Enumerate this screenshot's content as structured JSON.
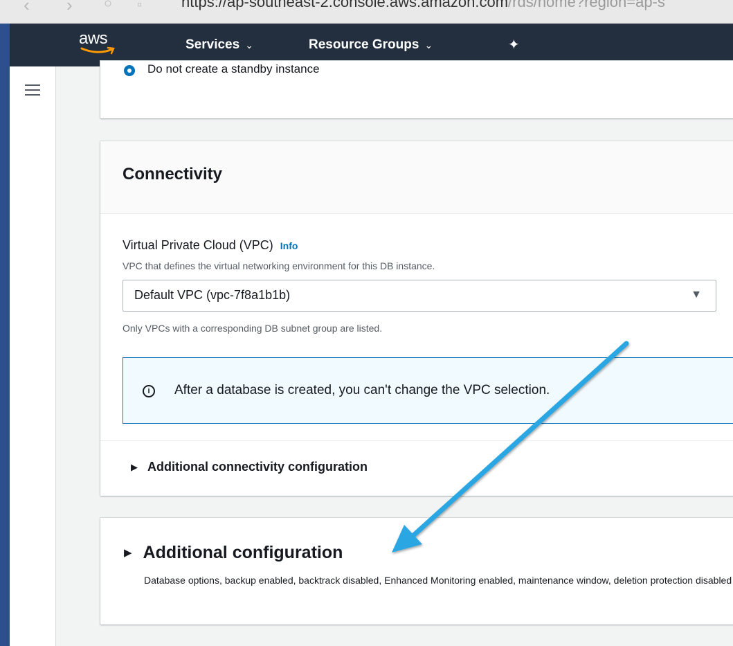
{
  "browser": {
    "url_dark": "https://ap-southeast-2.console.aws.amazon.com",
    "url_gray": "/rds/home?region=ap-s"
  },
  "header": {
    "logo": "aws",
    "services_label": "Services",
    "resource_groups_label": "Resource Groups",
    "colors": {
      "bar": "#232f3e",
      "accent": "#ff9900"
    }
  },
  "standby": {
    "option_label": "Do not create a standby instance"
  },
  "connectivity": {
    "title": "Connectivity",
    "vpc_label": "Virtual Private Cloud (VPC)",
    "info_link": "Info",
    "vpc_description": "VPC that defines the virtual networking environment for this DB instance.",
    "vpc_value": "Default VPC (vpc-7f8a1b1b)",
    "vpc_hint": "Only VPCs with a corresponding DB subnet group are listed.",
    "alert_text": "After a database is created, you can't change the VPC selection.",
    "additional_connectivity": "Additional connectivity configuration"
  },
  "additional": {
    "title": "Additional configuration",
    "description": "Database options, backup enabled, backtrack disabled, Enhanced Monitoring enabled, maintenance window, deletion protection disabled"
  },
  "annotation": {
    "arrow_color": "#2aa7e3"
  }
}
